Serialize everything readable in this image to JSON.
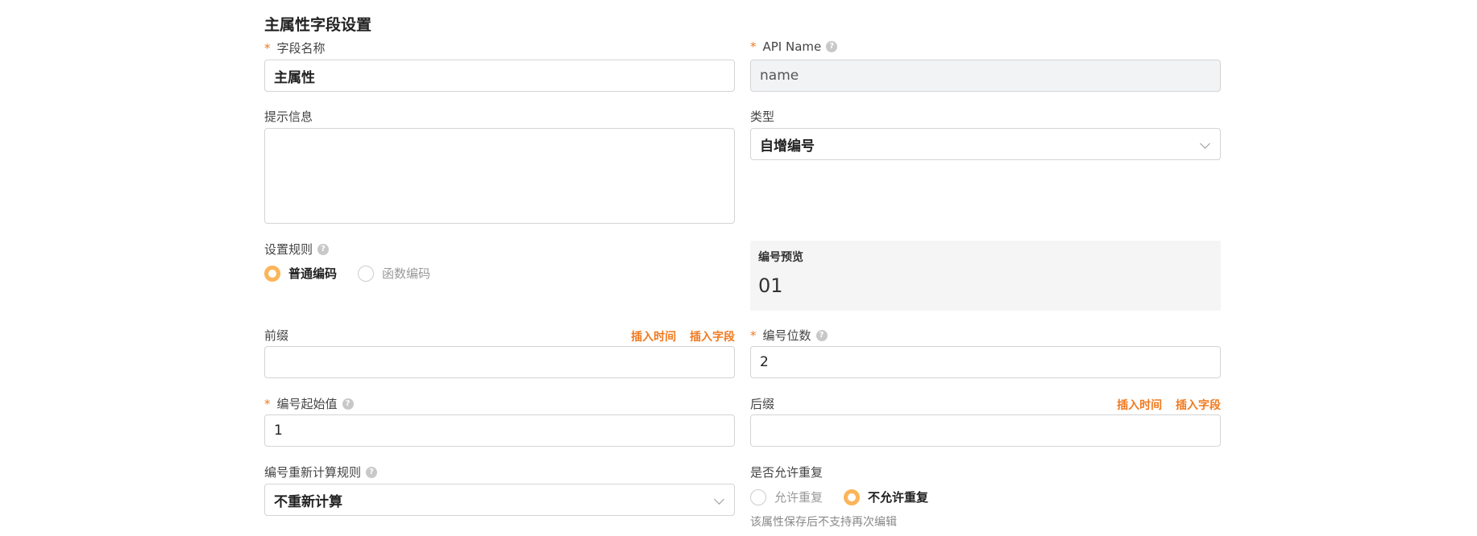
{
  "section_title": "主属性字段设置",
  "field_name": {
    "label": "字段名称",
    "value": "主属性"
  },
  "api_name": {
    "label": "API Name",
    "value": "name"
  },
  "hint_info": {
    "label": "提示信息",
    "value": ""
  },
  "type": {
    "label": "类型",
    "value": "自增编号"
  },
  "rule": {
    "label": "设置规则",
    "options": [
      "普通编码",
      "函数编码"
    ],
    "selected": 0
  },
  "preview": {
    "label": "编号预览",
    "value": "01"
  },
  "prefix": {
    "label": "前缀",
    "value": "",
    "insert_time": "插入时间",
    "insert_field": "插入字段"
  },
  "digits": {
    "label": "编号位数",
    "value": "2"
  },
  "start": {
    "label": "编号起始值",
    "value": "1"
  },
  "suffix": {
    "label": "后缀",
    "value": "",
    "insert_time": "插入时间",
    "insert_field": "插入字段"
  },
  "recalc": {
    "label": "编号重新计算规则",
    "value": "不重新计算"
  },
  "dup": {
    "label": "是否允许重复",
    "options": [
      "允许重复",
      "不允许重复"
    ],
    "selected": 1,
    "note": "该属性保存后不支持再次编辑"
  },
  "required_mark": "*",
  "help_glyph": "?",
  "colors": {
    "accent": "#f07a20",
    "radio_on": "#fbb55a"
  }
}
